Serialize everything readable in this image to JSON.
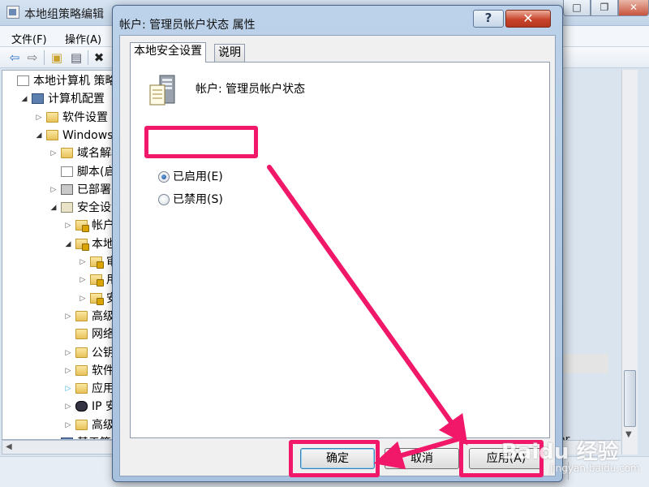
{
  "background_window": {
    "title": "本地组策略编辑",
    "menu": [
      "文件(F)",
      "操作(A)"
    ],
    "tree": [
      {
        "label": "本地计算机 策略",
        "indent": 0,
        "icon": "doc",
        "arrow": ""
      },
      {
        "label": "计算机配置",
        "indent": 1,
        "icon": "computer",
        "arrow": "open"
      },
      {
        "label": "软件设置",
        "indent": 2,
        "icon": "folder",
        "arrow": "closed"
      },
      {
        "label": "Windows",
        "indent": 2,
        "icon": "folder",
        "arrow": "open"
      },
      {
        "label": "域名解析",
        "indent": 3,
        "icon": "folder",
        "arrow": "closed"
      },
      {
        "label": "脚本(启",
        "indent": 3,
        "icon": "doc",
        "arrow": ""
      },
      {
        "label": "已部署的",
        "indent": 3,
        "icon": "printer",
        "arrow": "closed"
      },
      {
        "label": "安全设置",
        "indent": 3,
        "icon": "shield",
        "arrow": "open"
      },
      {
        "label": "帐户",
        "indent": 4,
        "icon": "folder-lock",
        "arrow": "closed"
      },
      {
        "label": "本地",
        "indent": 4,
        "icon": "folder-lock",
        "arrow": "open"
      },
      {
        "label": "审",
        "indent": 5,
        "icon": "folder-lock",
        "arrow": "closed"
      },
      {
        "label": "用",
        "indent": 5,
        "icon": "folder-lock",
        "arrow": "closed"
      },
      {
        "label": "安",
        "indent": 5,
        "icon": "folder-lock",
        "arrow": "closed"
      },
      {
        "label": "高级",
        "indent": 4,
        "icon": "folder",
        "arrow": "closed"
      },
      {
        "label": "网络",
        "indent": 4,
        "icon": "folder",
        "arrow": ""
      },
      {
        "label": "公钥",
        "indent": 4,
        "icon": "folder",
        "arrow": "closed"
      },
      {
        "label": "软件",
        "indent": 4,
        "icon": "folder",
        "arrow": "closed"
      },
      {
        "label": "应用",
        "indent": 4,
        "icon": "folder",
        "arrow": "cyan"
      },
      {
        "label": "IP 安",
        "indent": 4,
        "icon": "netkey",
        "arrow": "closed"
      },
      {
        "label": "高级",
        "indent": 4,
        "icon": "folder",
        "arrow": "closed"
      },
      {
        "label": "基于策",
        "indent": 3,
        "icon": "computer",
        "arrow": "closed"
      }
    ],
    "right_partial_text": "or"
  },
  "dialog": {
    "title": "帐户: 管理员帐户状态 属性",
    "help_label": "?",
    "close_label": "✕",
    "tabs": [
      {
        "label": "本地安全设置",
        "active": true
      },
      {
        "label": "说明",
        "active": false
      }
    ],
    "policy_name": "帐户: 管理员帐户状态",
    "options": [
      {
        "label": "已启用(E)",
        "checked": true
      },
      {
        "label": "已禁用(S)",
        "checked": false
      }
    ],
    "buttons": {
      "ok": "确定",
      "cancel": "取消",
      "apply": "应用(A)"
    }
  },
  "watermark": {
    "brand": "Baidu 经验",
    "url": "jingyan.baidu.com"
  },
  "colors": {
    "highlight": "#f1186a",
    "dialog_frame": "#a8c1de",
    "close_button": "#c8452c"
  }
}
